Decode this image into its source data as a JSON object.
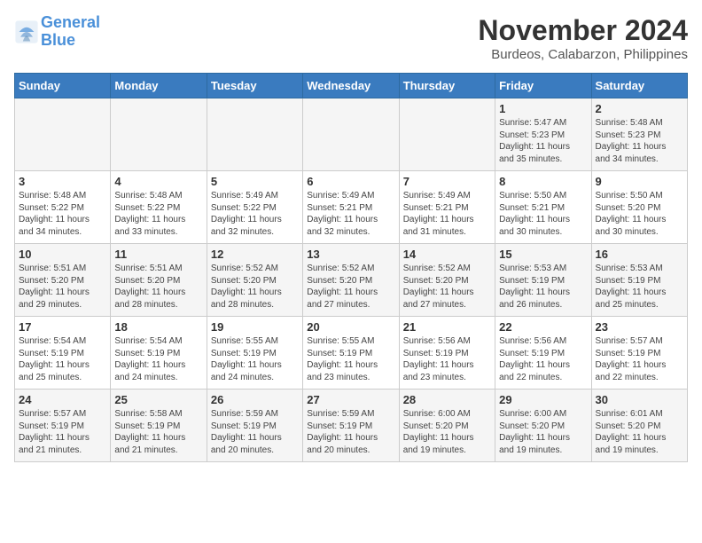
{
  "logo": {
    "line1": "General",
    "line2": "Blue"
  },
  "title": "November 2024",
  "subtitle": "Burdeos, Calabarzon, Philippines",
  "weekdays": [
    "Sunday",
    "Monday",
    "Tuesday",
    "Wednesday",
    "Thursday",
    "Friday",
    "Saturday"
  ],
  "weeks": [
    [
      {
        "day": "",
        "info": ""
      },
      {
        "day": "",
        "info": ""
      },
      {
        "day": "",
        "info": ""
      },
      {
        "day": "",
        "info": ""
      },
      {
        "day": "",
        "info": ""
      },
      {
        "day": "1",
        "info": "Sunrise: 5:47 AM\nSunset: 5:23 PM\nDaylight: 11 hours\nand 35 minutes."
      },
      {
        "day": "2",
        "info": "Sunrise: 5:48 AM\nSunset: 5:23 PM\nDaylight: 11 hours\nand 34 minutes."
      }
    ],
    [
      {
        "day": "3",
        "info": "Sunrise: 5:48 AM\nSunset: 5:22 PM\nDaylight: 11 hours\nand 34 minutes."
      },
      {
        "day": "4",
        "info": "Sunrise: 5:48 AM\nSunset: 5:22 PM\nDaylight: 11 hours\nand 33 minutes."
      },
      {
        "day": "5",
        "info": "Sunrise: 5:49 AM\nSunset: 5:22 PM\nDaylight: 11 hours\nand 32 minutes."
      },
      {
        "day": "6",
        "info": "Sunrise: 5:49 AM\nSunset: 5:21 PM\nDaylight: 11 hours\nand 32 minutes."
      },
      {
        "day": "7",
        "info": "Sunrise: 5:49 AM\nSunset: 5:21 PM\nDaylight: 11 hours\nand 31 minutes."
      },
      {
        "day": "8",
        "info": "Sunrise: 5:50 AM\nSunset: 5:21 PM\nDaylight: 11 hours\nand 30 minutes."
      },
      {
        "day": "9",
        "info": "Sunrise: 5:50 AM\nSunset: 5:20 PM\nDaylight: 11 hours\nand 30 minutes."
      }
    ],
    [
      {
        "day": "10",
        "info": "Sunrise: 5:51 AM\nSunset: 5:20 PM\nDaylight: 11 hours\nand 29 minutes."
      },
      {
        "day": "11",
        "info": "Sunrise: 5:51 AM\nSunset: 5:20 PM\nDaylight: 11 hours\nand 28 minutes."
      },
      {
        "day": "12",
        "info": "Sunrise: 5:52 AM\nSunset: 5:20 PM\nDaylight: 11 hours\nand 28 minutes."
      },
      {
        "day": "13",
        "info": "Sunrise: 5:52 AM\nSunset: 5:20 PM\nDaylight: 11 hours\nand 27 minutes."
      },
      {
        "day": "14",
        "info": "Sunrise: 5:52 AM\nSunset: 5:20 PM\nDaylight: 11 hours\nand 27 minutes."
      },
      {
        "day": "15",
        "info": "Sunrise: 5:53 AM\nSunset: 5:19 PM\nDaylight: 11 hours\nand 26 minutes."
      },
      {
        "day": "16",
        "info": "Sunrise: 5:53 AM\nSunset: 5:19 PM\nDaylight: 11 hours\nand 25 minutes."
      }
    ],
    [
      {
        "day": "17",
        "info": "Sunrise: 5:54 AM\nSunset: 5:19 PM\nDaylight: 11 hours\nand 25 minutes."
      },
      {
        "day": "18",
        "info": "Sunrise: 5:54 AM\nSunset: 5:19 PM\nDaylight: 11 hours\nand 24 minutes."
      },
      {
        "day": "19",
        "info": "Sunrise: 5:55 AM\nSunset: 5:19 PM\nDaylight: 11 hours\nand 24 minutes."
      },
      {
        "day": "20",
        "info": "Sunrise: 5:55 AM\nSunset: 5:19 PM\nDaylight: 11 hours\nand 23 minutes."
      },
      {
        "day": "21",
        "info": "Sunrise: 5:56 AM\nSunset: 5:19 PM\nDaylight: 11 hours\nand 23 minutes."
      },
      {
        "day": "22",
        "info": "Sunrise: 5:56 AM\nSunset: 5:19 PM\nDaylight: 11 hours\nand 22 minutes."
      },
      {
        "day": "23",
        "info": "Sunrise: 5:57 AM\nSunset: 5:19 PM\nDaylight: 11 hours\nand 22 minutes."
      }
    ],
    [
      {
        "day": "24",
        "info": "Sunrise: 5:57 AM\nSunset: 5:19 PM\nDaylight: 11 hours\nand 21 minutes."
      },
      {
        "day": "25",
        "info": "Sunrise: 5:58 AM\nSunset: 5:19 PM\nDaylight: 11 hours\nand 21 minutes."
      },
      {
        "day": "26",
        "info": "Sunrise: 5:59 AM\nSunset: 5:19 PM\nDaylight: 11 hours\nand 20 minutes."
      },
      {
        "day": "27",
        "info": "Sunrise: 5:59 AM\nSunset: 5:19 PM\nDaylight: 11 hours\nand 20 minutes."
      },
      {
        "day": "28",
        "info": "Sunrise: 6:00 AM\nSunset: 5:20 PM\nDaylight: 11 hours\nand 19 minutes."
      },
      {
        "day": "29",
        "info": "Sunrise: 6:00 AM\nSunset: 5:20 PM\nDaylight: 11 hours\nand 19 minutes."
      },
      {
        "day": "30",
        "info": "Sunrise: 6:01 AM\nSunset: 5:20 PM\nDaylight: 11 hours\nand 19 minutes."
      }
    ]
  ]
}
